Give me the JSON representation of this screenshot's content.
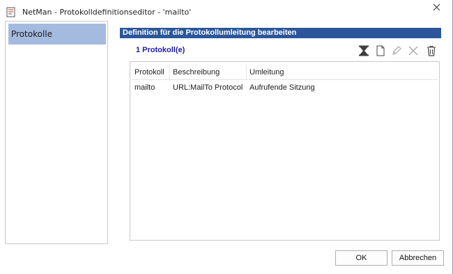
{
  "window": {
    "title": "NetMan - Protokolldefinitionseditor - 'mailto'",
    "icons": {
      "app": "document-edit-icon",
      "close": "close-icon"
    }
  },
  "sidebar": {
    "items": [
      {
        "label": "Protokolle",
        "selected": true
      }
    ]
  },
  "section": {
    "title": "Definition für die Protokollumleitung bearbeiten",
    "count_label": "1 Protokoll(e)",
    "toolbar": [
      {
        "name": "filter-icon",
        "enabled": true
      },
      {
        "name": "new-document-icon",
        "enabled": true
      },
      {
        "name": "edit-pencil-icon",
        "enabled": false
      },
      {
        "name": "delete-x-icon",
        "enabled": false
      },
      {
        "name": "trash-icon",
        "enabled": true
      }
    ]
  },
  "table": {
    "columns": [
      "Protokoll",
      "Beschreibung",
      "Umleitung"
    ],
    "rows": [
      {
        "protokoll": "mailto",
        "beschreibung": "URL:MailTo Protocol",
        "umleitung": "Aufrufende Sitzung"
      }
    ]
  },
  "buttons": {
    "ok": "OK",
    "cancel": "Abbrechen"
  },
  "colors": {
    "header_bg": "#2b579a",
    "selected_nav": "#a5badf",
    "count_text": "#1c1cab"
  }
}
